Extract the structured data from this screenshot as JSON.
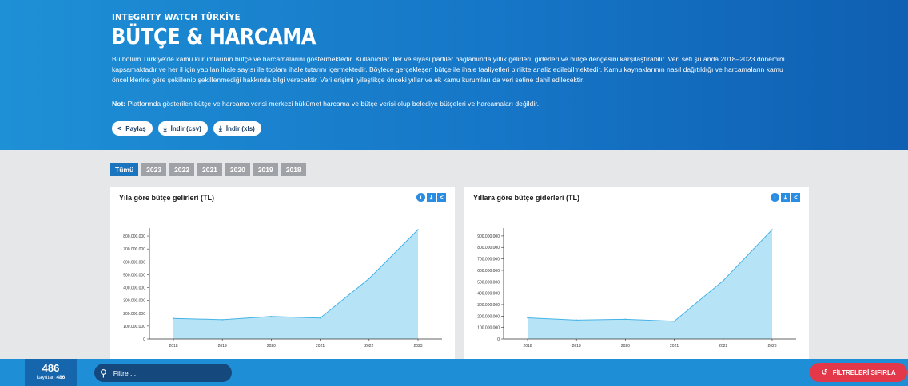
{
  "header": {
    "brand": "INTEGRITY WATCH TÜRKİYE",
    "title": "BÜTÇE & HARCAMA",
    "description": "Bu bölüm Türkiye'de kamu kurumlarının bütçe ve harcamalarını göstermektedir. Kullanıcılar iller ve siyasi partiler bağlamında yıllık gelirleri, giderleri ve bütçe dengesini karşılaştırabilir. Veri seti şu anda 2018–2023 dönemini kapsamaktadır ve her il için yapılan ihale sayısı ile toplam ihale tutarını içermektedir. Böylece gerçekleşen bütçe ile ihale faaliyetleri birlikte analiz edilebilmektedir. Kamu kaynaklarının nasıl dağıtıldığı ve harcamaların kamu önceliklerine göre şekillenip şekillenmediği hakkında bilgi verecektir. Veri erişimi iyileştikçe önceki yıllar ve ek kamu kurumları da veri setine dahil edilecektir.",
    "note_label": "Not:",
    "note_text": " Platformda gösterilen bütçe ve harcama verisi merkezi hükümet harcama ve bütçe verisi olup belediye bütçeleri ve harcamaları değildir.",
    "share_label": "Paylaş",
    "download_csv_label": "İndir (csv)",
    "download_xls_label": "İndir (xls)"
  },
  "year_filters": [
    "Tümü",
    "2023",
    "2022",
    "2021",
    "2020",
    "2019",
    "2018"
  ],
  "footer": {
    "count": "486",
    "of_label": "kayıttan",
    "of_total": "486",
    "search_placeholder": "Filtre ...",
    "reset_label": "FİLTRELERİ SIFIRLA"
  },
  "icons": {
    "share": "share-icon",
    "download": "download-icon",
    "info": "info-icon",
    "search": "search-icon",
    "reset": "reset-icon"
  },
  "colors": {
    "header": "#1676c7",
    "accent": "#1a74be",
    "area_fill": "#b6e3f6",
    "area_line": "#46b3e6",
    "reset": "#e3384a"
  },
  "chart_data": [
    {
      "type": "area",
      "title": "Yıla göre bütçe gelirleri (TL)",
      "x": [
        "2018",
        "2019",
        "2020",
        "2021",
        "2022",
        "2023"
      ],
      "values": [
        160000000,
        150000000,
        175000000,
        163000000,
        470000000,
        850000000
      ],
      "yticks": [
        0,
        100000000,
        200000000,
        300000000,
        400000000,
        500000000,
        600000000,
        700000000,
        800000000
      ],
      "ytick_labels": [
        "0",
        "100.000.000",
        "200.000.000",
        "300.000.000",
        "400.000.000",
        "500.000.000",
        "600.000.000",
        "700.000.000",
        "800.000.000"
      ],
      "ylim": [
        0,
        850000000
      ]
    },
    {
      "type": "area",
      "title": "Yıllara göre bütçe giderleri (TL)",
      "x": [
        "2018",
        "2019",
        "2020",
        "2021",
        "2022",
        "2023"
      ],
      "values": [
        185000000,
        165000000,
        172000000,
        155000000,
        510000000,
        955000000
      ],
      "yticks": [
        0,
        100000000,
        200000000,
        300000000,
        400000000,
        500000000,
        600000000,
        700000000,
        800000000,
        900000000
      ],
      "ytick_labels": [
        "0",
        "100.000.000",
        "200.000.000",
        "300.000.000",
        "400.000.000",
        "500.000.000",
        "600.000.000",
        "700.000.000",
        "800.000.000",
        "900.000.000"
      ],
      "ylim": [
        0,
        955000000
      ]
    }
  ]
}
